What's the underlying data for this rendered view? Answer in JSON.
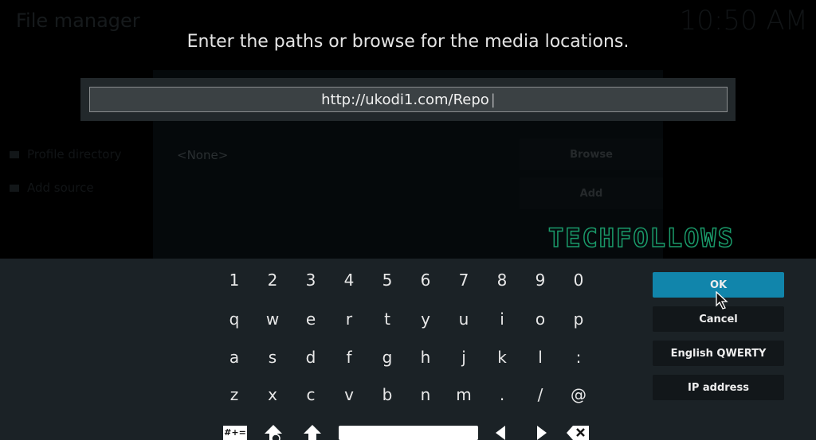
{
  "background": {
    "window_title": "File manager",
    "clock": "10:50 AM",
    "sidebar": [
      "Profile directory",
      "Add source"
    ],
    "source_value": "<None>",
    "browse_label": "Browse",
    "add_label": "Add"
  },
  "dialog": {
    "heading": "Enter the paths or browse for the media locations.",
    "input_value": "http://ukodi1.com/Repo"
  },
  "watermark": "TECHFOLLOWS",
  "keyboard": {
    "rows": [
      [
        "1",
        "2",
        "3",
        "4",
        "5",
        "6",
        "7",
        "8",
        "9",
        "0"
      ],
      [
        "q",
        "w",
        "e",
        "r",
        "t",
        "y",
        "u",
        "i",
        "o",
        "p"
      ],
      [
        "a",
        "s",
        "d",
        "f",
        "g",
        "h",
        "j",
        "k",
        "l",
        ":"
      ],
      [
        "z",
        "x",
        "c",
        "v",
        "b",
        "n",
        "m",
        ".",
        "/",
        "@"
      ]
    ],
    "symbols_label": "#+=",
    "buttons": {
      "ok": "OK",
      "cancel": "Cancel",
      "layout": "English QWERTY",
      "ip": "IP address"
    }
  },
  "colors": {
    "accent": "#1185ab",
    "keyboard_bg": "#1b2226",
    "watermark": "#1a9a6a"
  }
}
